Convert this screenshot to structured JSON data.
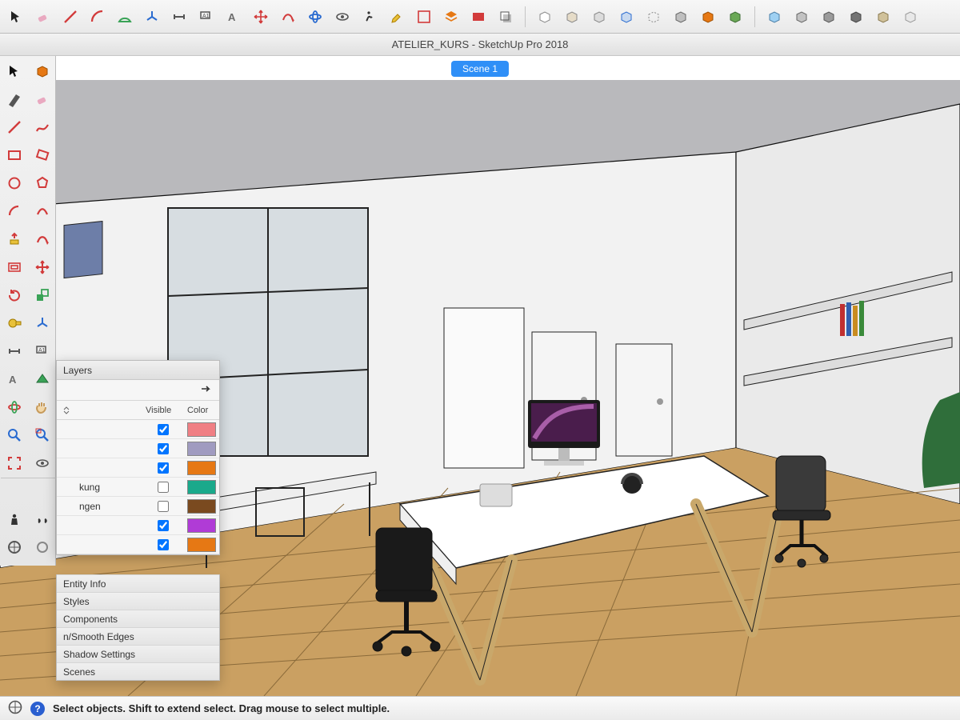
{
  "app": {
    "title": "ATELIER_KURS - SketchUp Pro 2018"
  },
  "scene_tab": "Scene 1",
  "status": {
    "hint": "Select objects. Shift to extend select. Drag mouse to select multiple."
  },
  "top_toolbar": [
    "select",
    "eraser",
    "line",
    "arc",
    "rectangle",
    "circle",
    "pushpull",
    "offset",
    "move",
    "rotate",
    "scale",
    "tape",
    "protractor",
    "axes",
    "dimension",
    "text",
    "3dtext",
    "section",
    "orbit",
    "pan",
    "zoom",
    "walk",
    "look",
    "paint",
    "outliner",
    "layers",
    "scenes",
    "shadow",
    "styles",
    "addlocation",
    "photo",
    "warehouse",
    "extensions",
    "componentA",
    "componentB",
    "componentC",
    "componentD",
    "componentE",
    "componentF",
    "boxA",
    "boxB",
    "boxC",
    "boxD",
    "boxE",
    "boxF",
    "boxG",
    "boxH"
  ],
  "palette": [
    "select-tool",
    "make-component-tool",
    "eraser-tool",
    "paint-bucket-tool",
    "line-tool",
    "freehand-tool",
    "rectangle-tool",
    "rotated-rectangle-tool",
    "circle-tool",
    "polygon-tool",
    "arc-tool",
    "2pt-arc-tool",
    "pushpull-tool",
    "followme-tool",
    "offset-tool",
    "move-tool",
    "rotate-tool",
    "scale-group-tool",
    "scale-tool",
    "tape-measure-tool",
    "protractor-tool",
    "axes-tool",
    "dimension-tool",
    "text-tool",
    "3dtext-tool",
    "section-tool",
    "orbit-tool",
    "pan-tool",
    "zoom-tool",
    "zoom-window-tool",
    "zoom-extents-tool",
    "look-around-tool",
    "walk-tool",
    "position-camera-tool",
    "paint-bucket2-tool",
    "sandbox-tool"
  ],
  "layers_panel": {
    "title": "Layers",
    "columns": {
      "visible": "Visible",
      "color": "Color"
    },
    "rows": [
      {
        "name": "",
        "visible": true,
        "color": "#f07f84"
      },
      {
        "name": "",
        "visible": true,
        "color": "#a09bc0"
      },
      {
        "name": "",
        "visible": true,
        "color": "#e67814"
      },
      {
        "name": "kung",
        "visible": false,
        "color": "#1aa98b"
      },
      {
        "name": "ngen",
        "visible": false,
        "color": "#7a4a1f"
      },
      {
        "name": "",
        "visible": true,
        "color": "#b03bd6"
      },
      {
        "name": "",
        "visible": true,
        "color": "#e67814"
      }
    ]
  },
  "tray": [
    "Entity Info",
    "Styles",
    "Components",
    "n/Smooth Edges",
    "Shadow Settings",
    "Scenes"
  ],
  "icon_colors": {
    "red": "#d23b3b",
    "yellow": "#e8c13a",
    "green": "#3aa357",
    "blue": "#2a6bd0",
    "gray": "#6c6c6c",
    "orange": "#e67814"
  }
}
